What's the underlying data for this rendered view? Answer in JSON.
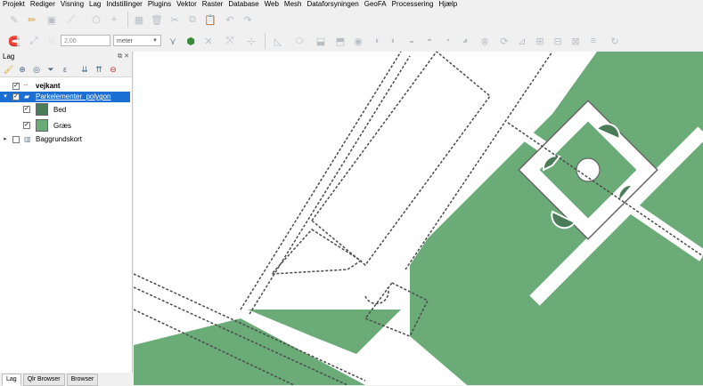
{
  "menubar": {
    "items": [
      "Projekt",
      "Rediger",
      "Visning",
      "Lag",
      "Indstillinger",
      "Plugins",
      "Vektor",
      "Raster",
      "Database",
      "Web",
      "Mesh",
      "Dataforsyningen",
      "GeoFA",
      "Processering",
      "Hjælp"
    ]
  },
  "toolbar": {
    "spin_value": "2,00",
    "unit_value": "meter"
  },
  "layers_panel": {
    "title": "Lag",
    "layers": [
      {
        "name": "vejkant",
        "checked": true
      },
      {
        "name": "Parkelementer_polygon",
        "checked": true,
        "selected": true
      },
      {
        "name": "Bed",
        "checked": true,
        "swatch": "#4a7c59"
      },
      {
        "name": "Græs",
        "checked": true,
        "swatch": "#6aab78"
      },
      {
        "name": "Baggrundskort",
        "checked": false
      }
    ]
  },
  "bottom_tabs": [
    "Lag",
    "Qlr Browser",
    "Browser"
  ],
  "colors": {
    "grass": "#6aab78",
    "bed": "#4a7c59",
    "selection": "#1b6fd2"
  }
}
